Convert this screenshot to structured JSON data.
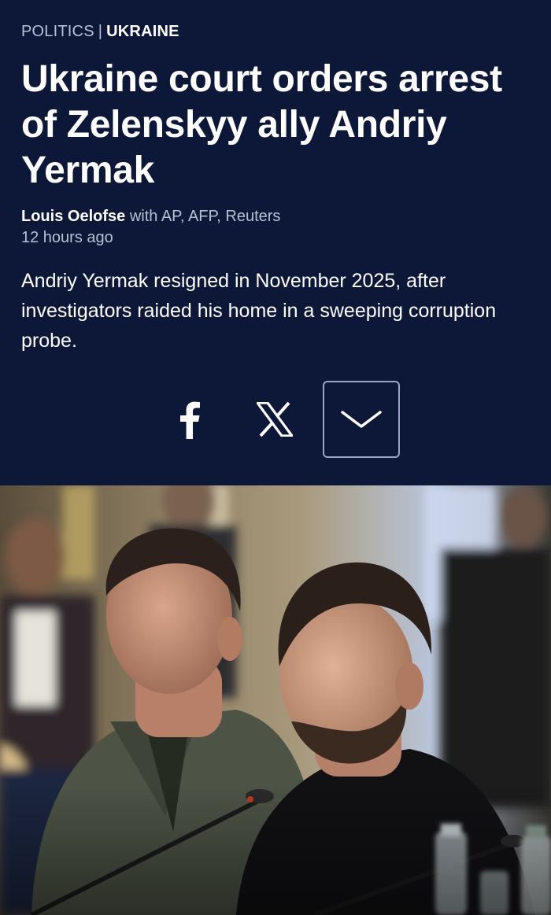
{
  "article": {
    "category": "POLITICS",
    "separator": "|",
    "subcategory": "UKRAINE",
    "headline": "Ukraine court orders arrest of Zelenskyy ally Andriy Yermak",
    "author": "Louis Oelofse",
    "contributors": "with AP, AFP, Reuters",
    "published": "12 hours ago",
    "summary": "Andriy Yermak resigned in November 2025, after investigators raided his home in a sweeping corruption probe."
  },
  "share": {
    "icons": [
      "facebook-icon",
      "x-icon",
      "chevron-down-icon"
    ]
  },
  "colors": {
    "header_bg": "#0d1838",
    "text_primary": "#ffffff",
    "text_secondary": "#b7c0d6",
    "button_border": "#9aa6c2"
  },
  "photo": {
    "icon": "news-photo"
  }
}
